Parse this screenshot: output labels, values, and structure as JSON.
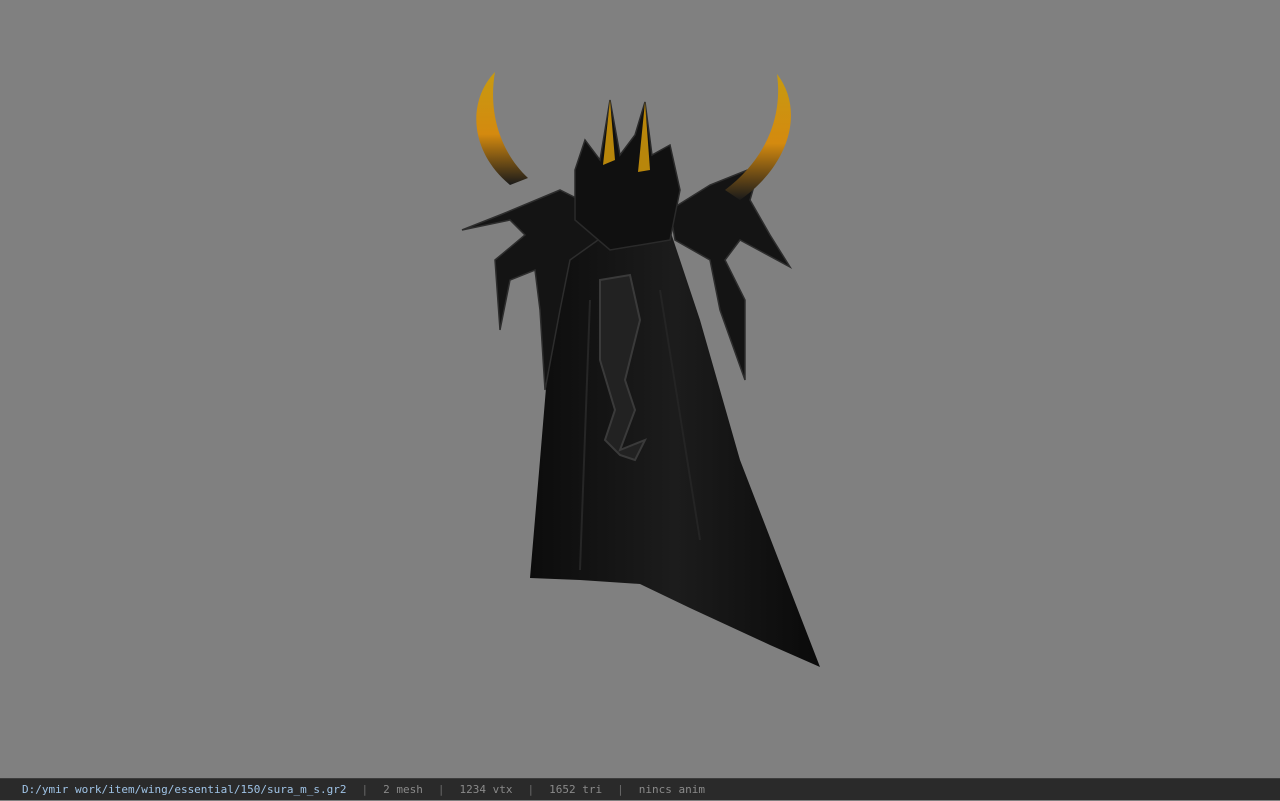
{
  "viewer": {
    "background_color": "#808080",
    "model_icon": "winged-cape-model"
  },
  "status_bar": {
    "file_path": "D:/ymir work/item/wing/essential/150/sura_m_s.gr2",
    "separator": "|",
    "mesh_count": "2 mesh",
    "vertex_count": "1234 vtx",
    "triangle_count": "1652 tri",
    "animation_status": "nincs anim"
  }
}
